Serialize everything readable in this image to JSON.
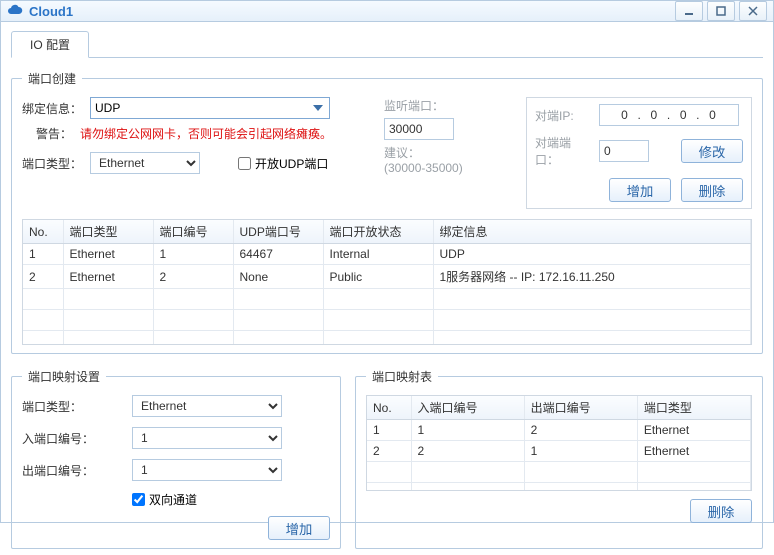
{
  "window": {
    "title": "Cloud1"
  },
  "tabs": {
    "io": "IO 配置"
  },
  "portCreate": {
    "legend": "端口创建",
    "labels": {
      "bindInfo": "绑定信息：",
      "warnLabel": "警告：",
      "warnMsg": "请勿绑定公网网卡，否则可能会引起网络瘫痪。",
      "portType": "端口类型：",
      "openUdp": "开放UDP端口",
      "listenPort": "监听端口：",
      "suggest": "建议：",
      "suggestRange": "(30000-35000)",
      "peerIp": "对端IP:",
      "peerPort": "对端端口：",
      "modify": "修改",
      "add": "增加",
      "delete": "删除"
    },
    "values": {
      "bindInfo": "UDP",
      "portType": "Ethernet",
      "listenPort": "30000",
      "peerIp": "0  .  0  .  0  .  0",
      "peerPort": "0"
    },
    "columns": [
      "No.",
      "端口类型",
      "端口编号",
      "UDP端口号",
      "端口开放状态",
      "绑定信息"
    ],
    "rows": [
      [
        "1",
        "Ethernet",
        "1",
        "64467",
        "Internal",
        "UDP"
      ],
      [
        "2",
        "Ethernet",
        "2",
        "None",
        "Public",
        "1服务器网络 -- IP: 172.16.11.250"
      ]
    ]
  },
  "portMapSet": {
    "legend": "端口映射设置",
    "labels": {
      "portType": "端口类型：",
      "inPortNo": "入端口编号：",
      "outPortNo": "出端口编号：",
      "twoWay": "双向通道",
      "add": "增加"
    },
    "values": {
      "portType": "Ethernet",
      "inPortNo": "1",
      "outPortNo": "1",
      "twoWayChecked": true
    }
  },
  "portMapTable": {
    "legend": "端口映射表",
    "labels": {
      "delete": "删除"
    },
    "columns": [
      "No.",
      "入端口编号",
      "出端口编号",
      "端口类型"
    ],
    "rows": [
      [
        "1",
        "1",
        "2",
        "Ethernet"
      ],
      [
        "2",
        "2",
        "1",
        "Ethernet"
      ]
    ]
  }
}
